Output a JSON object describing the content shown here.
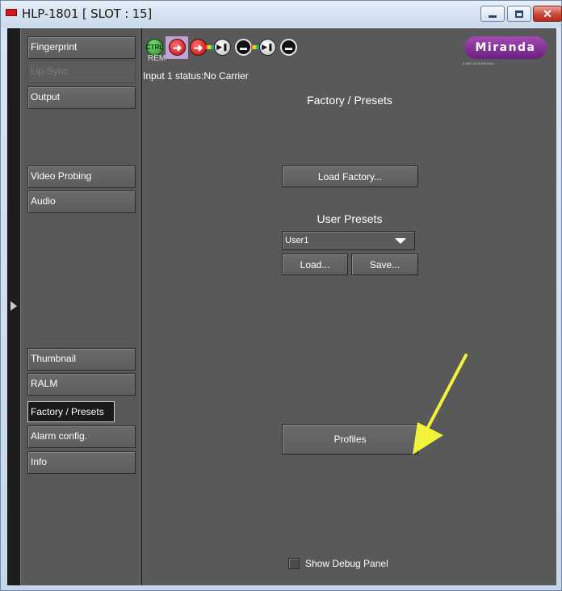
{
  "window": {
    "title": "HLP-1801 [ SLOT : 15]",
    "close_glyph": "✕"
  },
  "nav": {
    "items": [
      {
        "label": "Fingerprint",
        "state": "normal"
      },
      {
        "label": "Lip-Sync",
        "state": "disabled"
      },
      {
        "label": "Output",
        "state": "normal"
      },
      {
        "label": "Video Probing",
        "state": "normal"
      },
      {
        "label": "Audio",
        "state": "normal"
      },
      {
        "label": "Thumbnail",
        "state": "normal"
      },
      {
        "label": "RALM",
        "state": "normal"
      },
      {
        "label": "Factory / Presets",
        "state": "selected"
      },
      {
        "label": "Alarm config.",
        "state": "normal"
      },
      {
        "label": "Info",
        "state": "normal"
      }
    ]
  },
  "toolbar": {
    "ctrl_label": "CTRL",
    "rem_label": "REM",
    "logo_text": "Miranda",
    "logo_sub": "A BELDEN BRAND",
    "icons": [
      "ctrl-icon",
      "input-arrow-icon",
      "output-arrow-icon",
      "play-icon",
      "video-icon",
      "play-icon",
      "video-icon"
    ]
  },
  "main": {
    "status": "Input 1 status:No Carrier",
    "title": "Factory / Presets",
    "load_factory_label": "Load Factory...",
    "user_presets_label": "User Presets",
    "preset_select_value": "User1",
    "load_label": "Load...",
    "save_label": "Save...",
    "profiles_label": "Profiles",
    "debug_label": "Show Debug Panel",
    "debug_checked": false
  },
  "colors": {
    "panel_bg": "#595959",
    "annotation_arrow": "#f2f23a",
    "logo_purple": "#8a2fa0"
  }
}
